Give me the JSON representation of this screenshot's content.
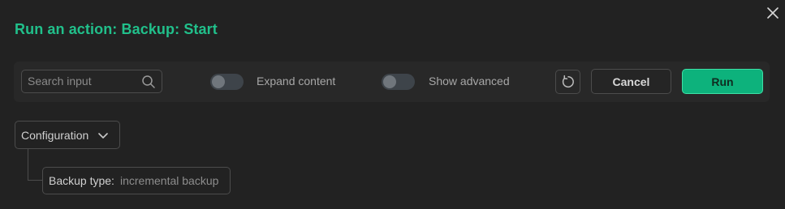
{
  "dialog": {
    "title": "Run an action: Backup: Start",
    "close_icon": "close-icon"
  },
  "toolbar": {
    "search": {
      "placeholder": "Search input",
      "value": "",
      "icon": "search-icon"
    },
    "toggles": [
      {
        "label": "Expand content",
        "checked": false
      },
      {
        "label": "Show advanced",
        "checked": false
      }
    ],
    "reset_icon": "reset-icon",
    "cancel_label": "Cancel",
    "run_label": "Run"
  },
  "config": {
    "dropdown_label": "Configuration",
    "dropdown_icon": "chevron-down-icon",
    "fields": [
      {
        "label": "Backup type:",
        "value": "incremental backup"
      }
    ]
  },
  "colors": {
    "accent": "#21c08b",
    "run_button": "#0db27c",
    "background": "#222222",
    "border": "#4c4c4c"
  }
}
